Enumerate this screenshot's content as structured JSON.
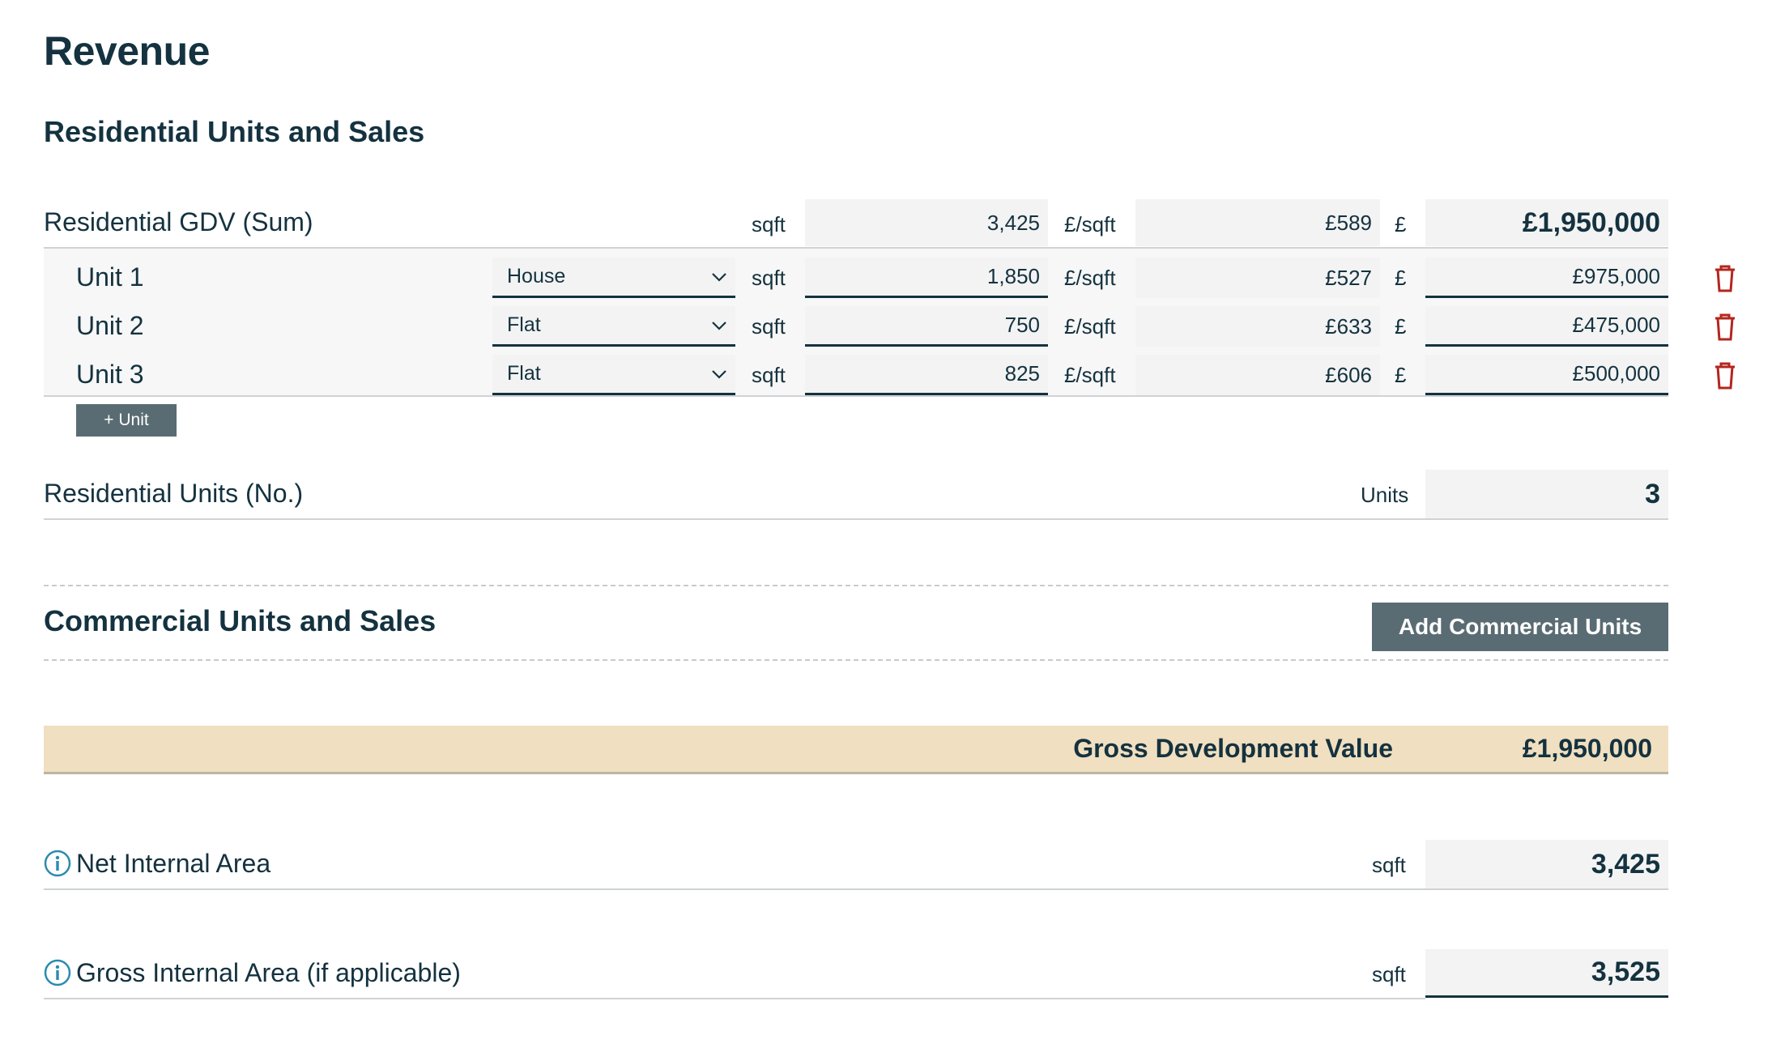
{
  "page": {
    "title": "Revenue"
  },
  "residential": {
    "heading": "Residential Units and Sales",
    "gdv": {
      "label": "Residential GDV (Sum)",
      "area_unit": "sqft",
      "area": "3,425",
      "rate_unit": "£/sqft",
      "rate": "£589",
      "currency": "£",
      "total": "£1,950,000"
    },
    "units": [
      {
        "label": "Unit 1",
        "type": "House",
        "area_unit": "sqft",
        "area": "1,850",
        "rate_unit": "£/sqft",
        "rate": "£527",
        "currency": "£",
        "value": "£975,000"
      },
      {
        "label": "Unit 2",
        "type": "Flat",
        "area_unit": "sqft",
        "area": "750",
        "rate_unit": "£/sqft",
        "rate": "£633",
        "currency": "£",
        "value": "£475,000"
      },
      {
        "label": "Unit 3",
        "type": "Flat",
        "area_unit": "sqft",
        "area": "825",
        "rate_unit": "£/sqft",
        "rate": "£606",
        "currency": "£",
        "value": "£500,000"
      }
    ],
    "add_unit_label": "+ Unit",
    "count": {
      "label": "Residential Units (No.)",
      "unit": "Units",
      "value": "3"
    }
  },
  "commercial": {
    "heading": "Commercial Units and Sales",
    "add_button_label": "Add Commercial Units"
  },
  "gdv_total": {
    "label": "Gross Development Value",
    "value": "£1,950,000"
  },
  "nia": {
    "label": "Net Internal Area",
    "unit": "sqft",
    "value": "3,425"
  },
  "gia": {
    "label": "Gross Internal Area (if applicable)",
    "unit": "sqft",
    "value": "3,525"
  },
  "colors": {
    "primary": "#14323f",
    "button": "#5a6c73",
    "highlight": "#f0dfc0",
    "danger": "#b3261e",
    "info": "#2b8bb0"
  }
}
